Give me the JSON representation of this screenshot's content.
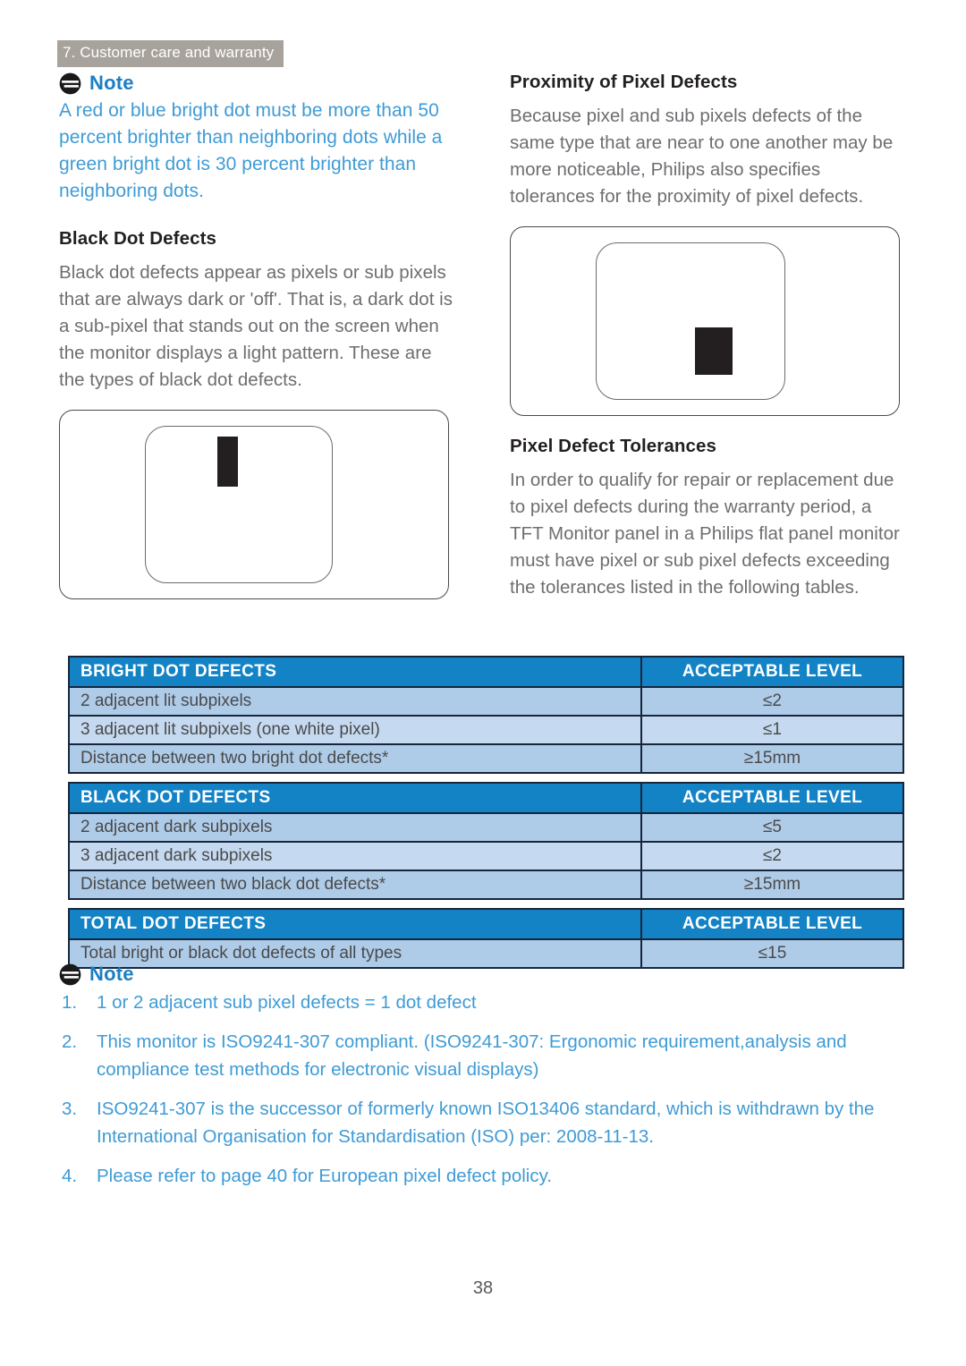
{
  "header": {
    "breadcrumb": "7. Customer care and warranty"
  },
  "left_column": {
    "note_label": "Note",
    "note_icon": "note-info-icon",
    "note_text": "A red or blue bright dot must be more than 50 percent brighter than neighboring dots while a green bright dot is 30 percent brighter than neighboring dots.",
    "section_heading": "Black Dot Defects",
    "section_text": "Black dot defects appear as pixels or sub pixels that are always dark or 'off'. That is, a dark dot is a sub-pixel that stands out on the screen when the monitor displays a light pattern. These are the types of black dot defects.",
    "illustration_name": "black-dot-defect-monitor-illustration"
  },
  "right_column": {
    "heading_proximity": "Proximity of Pixel Defects",
    "text_proximity": "Because pixel and sub pixels defects of the same type that are near to one another may be more noticeable, Philips also specifies tolerances for the proximity of pixel defects.",
    "illustration_name": "pixel-defect-proximity-monitor-illustration",
    "heading_tolerances": "Pixel Defect Tolerances",
    "text_tolerances": "In order to qualify for repair or replacement due to pixel defects during the warranty period, a TFT Monitor panel in a Philips flat panel monitor must have pixel or sub pixel defects exceeding the tolerances listed in the following tables."
  },
  "tables": [
    {
      "header": [
        "BRIGHT DOT DEFECTS",
        "ACCEPTABLE LEVEL"
      ],
      "rows": [
        [
          "2 adjacent lit subpixels",
          "≤2"
        ],
        [
          "3 adjacent lit subpixels (one white pixel)",
          "≤1"
        ],
        [
          "Distance between two bright dot defects*",
          "≥15mm"
        ]
      ]
    },
    {
      "header": [
        "BLACK DOT DEFECTS",
        "ACCEPTABLE LEVEL"
      ],
      "rows": [
        [
          "2 adjacent dark subpixels",
          "≤5"
        ],
        [
          "3 adjacent dark subpixels",
          "≤2"
        ],
        [
          "Distance between two black dot defects*",
          "≥15mm"
        ]
      ]
    },
    {
      "header": [
        "TOTAL DOT DEFECTS",
        "ACCEPTABLE LEVEL"
      ],
      "rows": [
        [
          "Total bright or black dot defects of all types",
          "≤15"
        ]
      ]
    }
  ],
  "bottom_note": {
    "label": "Note",
    "icon": "note-info-icon",
    "items": [
      "1 or 2 adjacent sub pixel defects = 1 dot defect",
      "This monitor is ISO9241-307 compliant. (ISO9241-307: Ergonomic requirement,analysis and compliance test methods for electronic visual displays)",
      "ISO9241-307 is the successor of formerly known ISO13406 standard, which is withdrawn by the International Organisation for Standardisation (ISO) per: 2008-11-13.",
      "Please refer to page 40 for European pixel defect policy."
    ]
  },
  "footer": {
    "page_number": "38"
  },
  "colors": {
    "breadcrumb_bg": "#a8a29c",
    "note_blue": "#3e9bd6",
    "note_label_blue": "#1b7fc4",
    "table_header_blue": "#1383c6",
    "table_row_a": "#aecbe8",
    "table_row_b": "#c5d9f0",
    "table_border": "#16263c",
    "body_text": "#6d6e71",
    "heading_text": "#231f20"
  }
}
